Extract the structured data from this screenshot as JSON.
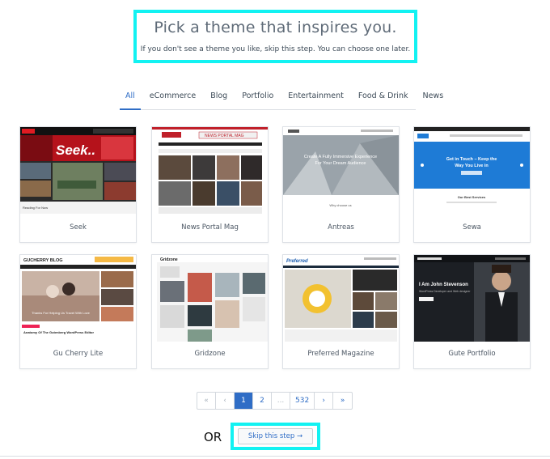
{
  "header": {
    "title": "Pick a theme that inspires you.",
    "subtitle": "If you don't see a theme you like, skip this step. You can choose one later."
  },
  "filters": [
    "All",
    "eCommerce",
    "Blog",
    "Portfolio",
    "Entertainment",
    "Food & Drink",
    "News"
  ],
  "active_filter": "All",
  "themes": [
    {
      "name": "Seek",
      "preview": {
        "logo": "Seek..",
        "caption": "Reading For Now"
      }
    },
    {
      "name": "News Portal Mag",
      "preview": {
        "banner": "NEWS PORTAL MAG"
      }
    },
    {
      "name": "Antreas",
      "preview": {
        "headline": "Create A Fully Immersive Experience For Your Dream Audience",
        "caption": "Why choose us"
      }
    },
    {
      "name": "Sewa",
      "preview": {
        "headline": "Get in Touch – Keep the Way You Live in",
        "caption": "Our Best Services"
      }
    },
    {
      "name": "Gu Cherry Lite",
      "preview": {
        "logo": "GUCHERRY BLOG",
        "caption": "Thanks For Helping Us Travel With Love",
        "post": "Anatomy Of The Gutenberg WordPress Editor"
      }
    },
    {
      "name": "Gridzone",
      "preview": {
        "logo": "Gridzone"
      }
    },
    {
      "name": "Preferred Magazine",
      "preview": {
        "logo": "Preferred"
      }
    },
    {
      "name": "Gute Portfolio",
      "preview": {
        "headline": "I Am John Stevenson",
        "caption": "WordPress Developer and Web designer"
      }
    }
  ],
  "pagination": {
    "first": "«",
    "prev": "‹",
    "pages": [
      "1",
      "2",
      "...",
      "532"
    ],
    "next": "›",
    "last": "»",
    "current": "1"
  },
  "or_text": "OR",
  "skip_label": "Skip this step →",
  "colors": {
    "accent": "#2f6dc6",
    "highlight": "#12f2f2",
    "sewa_blue": "#1e7bd6",
    "seek_red": "#e11b22"
  }
}
